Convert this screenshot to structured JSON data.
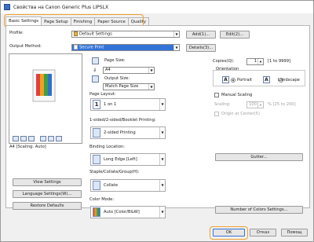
{
  "window": {
    "title": "Свойства на Canon Generic Plus LIPSLX"
  },
  "tabs": [
    "Basic Settings",
    "Page Setup",
    "Finishing",
    "Paper Source",
    "Quality"
  ],
  "profile": {
    "label": "Profile:",
    "value": "Default Settings",
    "add": "Add(1)...",
    "edit": "Edit(2)..."
  },
  "output": {
    "label": "Output Method:",
    "value": "Secure Print",
    "details": "Details(3)..."
  },
  "preview": {
    "caption": "A4 [Scaling: Auto]"
  },
  "left_buttons": {
    "view": "View Settings",
    "language": "Language Settings(W)...",
    "restore": "Restore Defaults"
  },
  "page_size": {
    "label": "Page Size:",
    "value": "A4"
  },
  "output_size": {
    "label": "Output Size:",
    "value": "Match Page Size"
  },
  "page_layout": {
    "label": "Page Layout:",
    "value": "1 on 1",
    "icon_text": "1"
  },
  "printing": {
    "label": "1-sided/2-sided/Booklet Printing:",
    "value": "2-sided Printing"
  },
  "binding": {
    "label": "Binding Location:",
    "value": "Long Edge [Left]"
  },
  "staple": {
    "label": "Staple/Collate/Group(H):",
    "value": "Collate"
  },
  "color_mode": {
    "label": "Color Mode:",
    "value": "Auto [Color/B&W]"
  },
  "copies": {
    "label": "Copies(Q):",
    "value": "1",
    "range": "[1 to 9999]"
  },
  "orientation": {
    "label": "Orientation",
    "portrait": "Portrait",
    "landscape": "Landscape",
    "selected": "portrait"
  },
  "scaling": {
    "manual": "Manual Scaling",
    "label": "Scaling:",
    "value": "100",
    "range": "% [25 to 200]",
    "center": "Origin at Center(5)"
  },
  "gutter": "Gutter...",
  "num_colors": "Number of Colors Settings...",
  "footer": {
    "ok": "OK",
    "cancel": "Отказ",
    "help": "Помощ"
  }
}
